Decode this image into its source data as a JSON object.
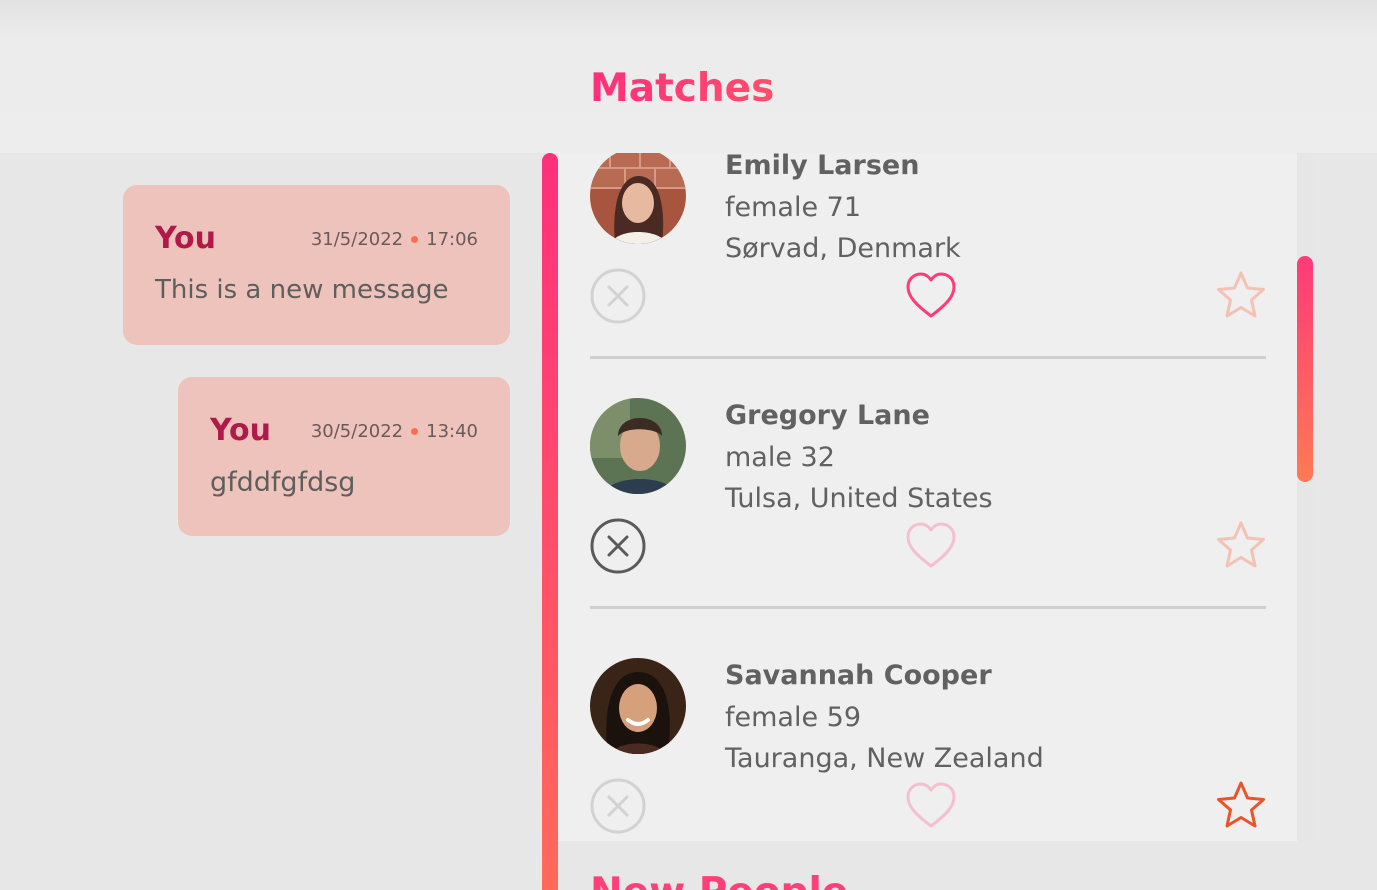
{
  "header": {
    "title": "Matches"
  },
  "messages": [
    {
      "author": "You",
      "date": "31/5/2022",
      "time": "17:06",
      "text": "This is a new message"
    },
    {
      "author": "You",
      "date": "30/5/2022",
      "time": "13:40",
      "text": "gfddfgfdsg"
    }
  ],
  "matches": [
    {
      "name": "Emily Larsen",
      "gender_age": "female 71",
      "location": "Sørvad, Denmark",
      "liked": true,
      "favorited": false,
      "rejected": false
    },
    {
      "name": "Gregory Lane",
      "gender_age": "male 32",
      "location": "Tulsa, United States",
      "liked": false,
      "favorited": false,
      "rejected": true
    },
    {
      "name": "Savannah Cooper",
      "gender_age": "female 59",
      "location": "Tauranga, New Zealand",
      "liked": false,
      "favorited": true,
      "rejected": false
    }
  ],
  "bottom": {
    "heading": "New People"
  },
  "colors": {
    "accent": "#ff3f78",
    "accent_end": "#ff6a5a",
    "bubble": "#eec3bb",
    "author": "#b01a4a"
  },
  "icons": {
    "reject": "close-circle-icon",
    "like": "heart-icon",
    "favorite": "star-icon"
  }
}
